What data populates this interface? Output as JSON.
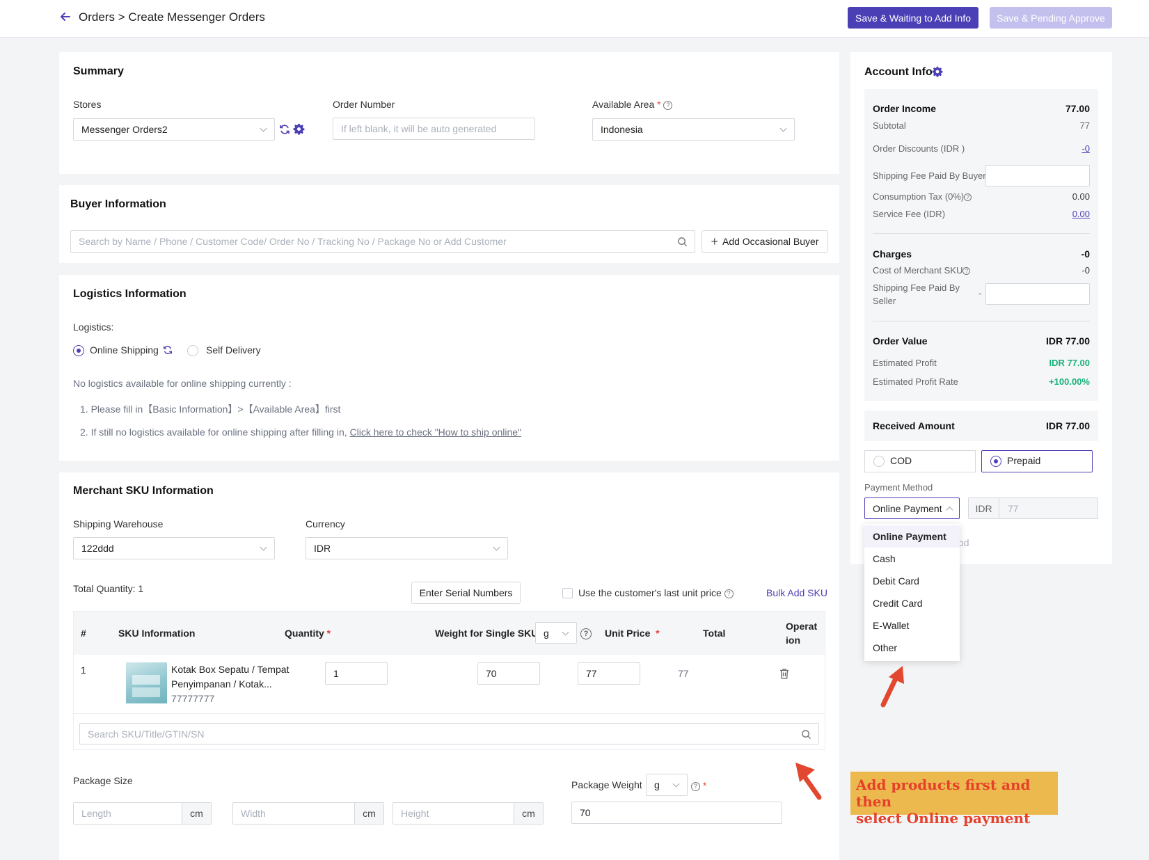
{
  "header": {
    "breadcrumb": "Orders > Create Messenger Orders",
    "save_waiting": "Save & Waiting to Add Info",
    "save_pending": "Save & Pending Approve"
  },
  "summary": {
    "title": "Summary",
    "stores_label": "Stores",
    "stores_value": "Messenger Orders2",
    "order_number_label": "Order Number",
    "order_number_placeholder": "If left blank, it will be auto generated",
    "area_label": "Available Area",
    "area_value": "Indonesia"
  },
  "buyer": {
    "title": "Buyer Information",
    "search_placeholder": "Search by Name / Phone / Customer Code/ Order No / Tracking No / Package No or Add Customer",
    "add_button": "Add Occasional Buyer"
  },
  "logistics": {
    "title": "Logistics Information",
    "label": "Logistics:",
    "online": "Online Shipping",
    "self": "Self Delivery",
    "notice": "No logistics available for online shipping currently :",
    "step1": "1. Please fill in【Basic Information】>【Available Area】first",
    "step2_prefix": "2. If still no logistics available for online shipping after filling in, ",
    "step2_link": "Click here to check \"How to ship online\""
  },
  "sku": {
    "title": "Merchant SKU Information",
    "warehouse_label": "Shipping Warehouse",
    "warehouse_value": "122ddd",
    "currency_label": "Currency",
    "currency_value": "IDR",
    "total_qty": "Total Quantity: 1",
    "serial_button": "Enter Serial Numbers",
    "last_price_label": "Use the customer's last unit price",
    "bulk_add": "Bulk Add SKU",
    "columns": {
      "num": "#",
      "info": "SKU Information",
      "qty": "Quantity",
      "weight": "Weight for Single SKU",
      "weight_unit": "g",
      "price": "Unit Price",
      "total": "Total",
      "op": "Operat ion"
    },
    "rows": [
      {
        "num": "1",
        "name1": "Kotak Box Sepatu / Tempat",
        "name2": "Penyimpanan / Kotak...",
        "code": "77777777",
        "qty": "1",
        "weight": "70",
        "price": "77",
        "total": "77"
      }
    ],
    "search_placeholder": "Search SKU/Title/GTIN/SN"
  },
  "package": {
    "size_label": "Package Size",
    "length_ph": "Length",
    "width_ph": "Width",
    "height_ph": "Height",
    "unit_cm": "cm",
    "weight_label": "Package Weight",
    "weight_unit": "g",
    "weight_value": "70"
  },
  "account": {
    "title": "Account Info",
    "order_income_label": "Order Income",
    "order_income": "77.00",
    "subtotal_label": "Subtotal",
    "subtotal": "77",
    "discounts_label": "Order Discounts (IDR )",
    "discounts": "-0",
    "ship_buyer_label": "Shipping Fee Paid By Buyer",
    "tax_label": "Consumption Tax (0%)",
    "tax": "0.00",
    "service_label": "Service Fee (IDR)",
    "service": "0.00",
    "charges_label": "Charges",
    "charges": "-0",
    "cost_label": "Cost of Merchant SKU",
    "cost": "-0",
    "ship_seller_label1": "Shipping Fee Paid By",
    "ship_seller_label2": "Seller",
    "ship_seller_dash": "-",
    "order_value_label": "Order Value",
    "order_value": "IDR 77.00",
    "profit_label": "Estimated Profit",
    "profit": "IDR 77.00",
    "profit_rate_label": "Estimated Profit Rate",
    "profit_rate": "+100.00%",
    "received_label": "Received Amount",
    "received": "IDR 77.00",
    "cod": "COD",
    "prepaid": "Prepaid",
    "payment_label": "Payment Method",
    "payment_value": "Online Payment",
    "currency": "IDR",
    "amount": "77",
    "hidden_suffix": "od",
    "options": [
      "Online Payment",
      "Cash",
      "Debit Card",
      "Credit Card",
      "E-Wallet",
      "Other"
    ]
  },
  "annotation": {
    "line1": "Add products first and then",
    "line2": "select Online payment"
  },
  "colors": {
    "primary": "#4b3fb5",
    "disabled": "#c4c0ee",
    "green": "#18b27a",
    "annotation_bg": "#ecb94f",
    "annotation_text": "#e6402a",
    "arrow": "#e2472f"
  }
}
